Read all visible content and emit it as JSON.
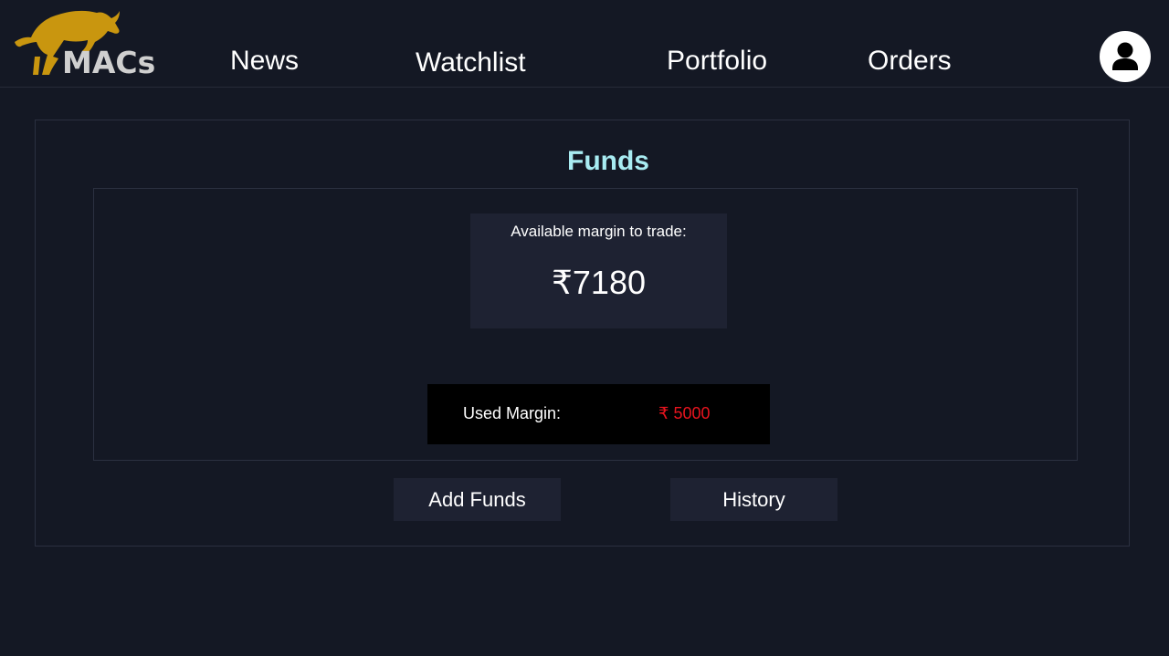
{
  "header": {
    "logo_text": "MACs",
    "logo_icon": "bull-icon",
    "brand_color": "#c9960f",
    "nav": {
      "news": "News",
      "watchlist": "Watchlist",
      "portfolio": "Portfolio",
      "orders": "Orders"
    },
    "profile_icon": "user-icon"
  },
  "funds": {
    "title": "Funds",
    "title_color": "#a8ecf2",
    "available_label": "Available margin to trade:",
    "available_amount": "₹7180",
    "used_label": "Used Margin:",
    "used_amount": "₹ 5000",
    "used_amount_color": "#e8141e",
    "add_funds_label": "Add Funds",
    "history_label": "History"
  }
}
